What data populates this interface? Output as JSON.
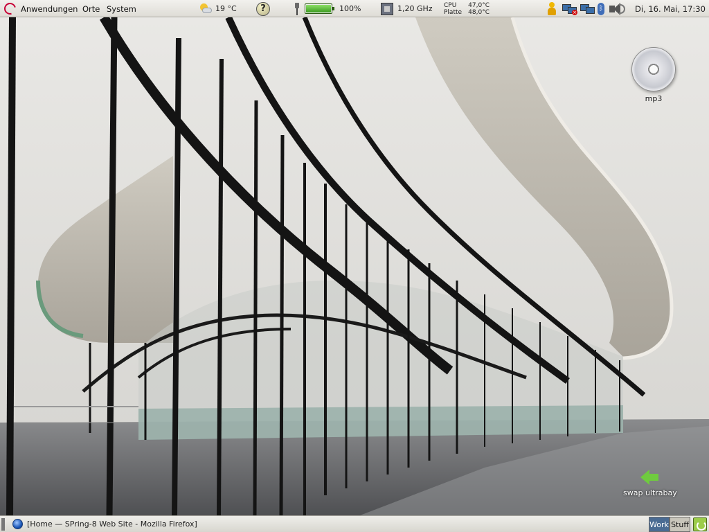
{
  "top_panel": {
    "menus": [
      {
        "label": "Anwendungen"
      },
      {
        "label": "Orte"
      },
      {
        "label": "System"
      }
    ],
    "weather": {
      "icon": "partly-cloudy-icon",
      "text": "19 °C"
    },
    "help": {
      "icon": "help-icon",
      "glyph": "?"
    },
    "power": {
      "icon": "power-plug-icon",
      "battery_percent": 100,
      "text": "100%"
    },
    "cpu_frequency": {
      "icon": "cpu-icon",
      "text": "1,20 GHz"
    },
    "sensors": {
      "cpu_label": "CPU",
      "cpu_value": "47,0°C",
      "disk_label": "Platte",
      "disk_value": "48,0°C"
    },
    "tray": {
      "icons": [
        "user-icon",
        "network-disconnected-icon",
        "network-icon",
        "bluetooth-icon",
        "volume-icon"
      ],
      "bluetooth_glyph": "ᛒ"
    },
    "clock": "Di, 16. Mai, 17:30"
  },
  "desktop": {
    "icons": [
      {
        "name": "cd-icon",
        "label": "mp3"
      },
      {
        "name": "back-arrow-icon",
        "label": "swap ultrabay"
      }
    ]
  },
  "bottom_panel": {
    "task": {
      "icon": "firefox-icon",
      "label": "[Home — SPring-8 Web Site - Mozilla Firefox]"
    },
    "workspaces": [
      {
        "label": "Work",
        "active": true
      },
      {
        "label": "Stuff",
        "active": false
      }
    ],
    "trash_icon": "trash-icon"
  },
  "colors": {
    "panel": "#e6e4de",
    "active_workspace": "#4a6b93",
    "battery_fill": "#3b9a1f",
    "window_glass": "#5f8e84",
    "building_frame": "#141414"
  }
}
